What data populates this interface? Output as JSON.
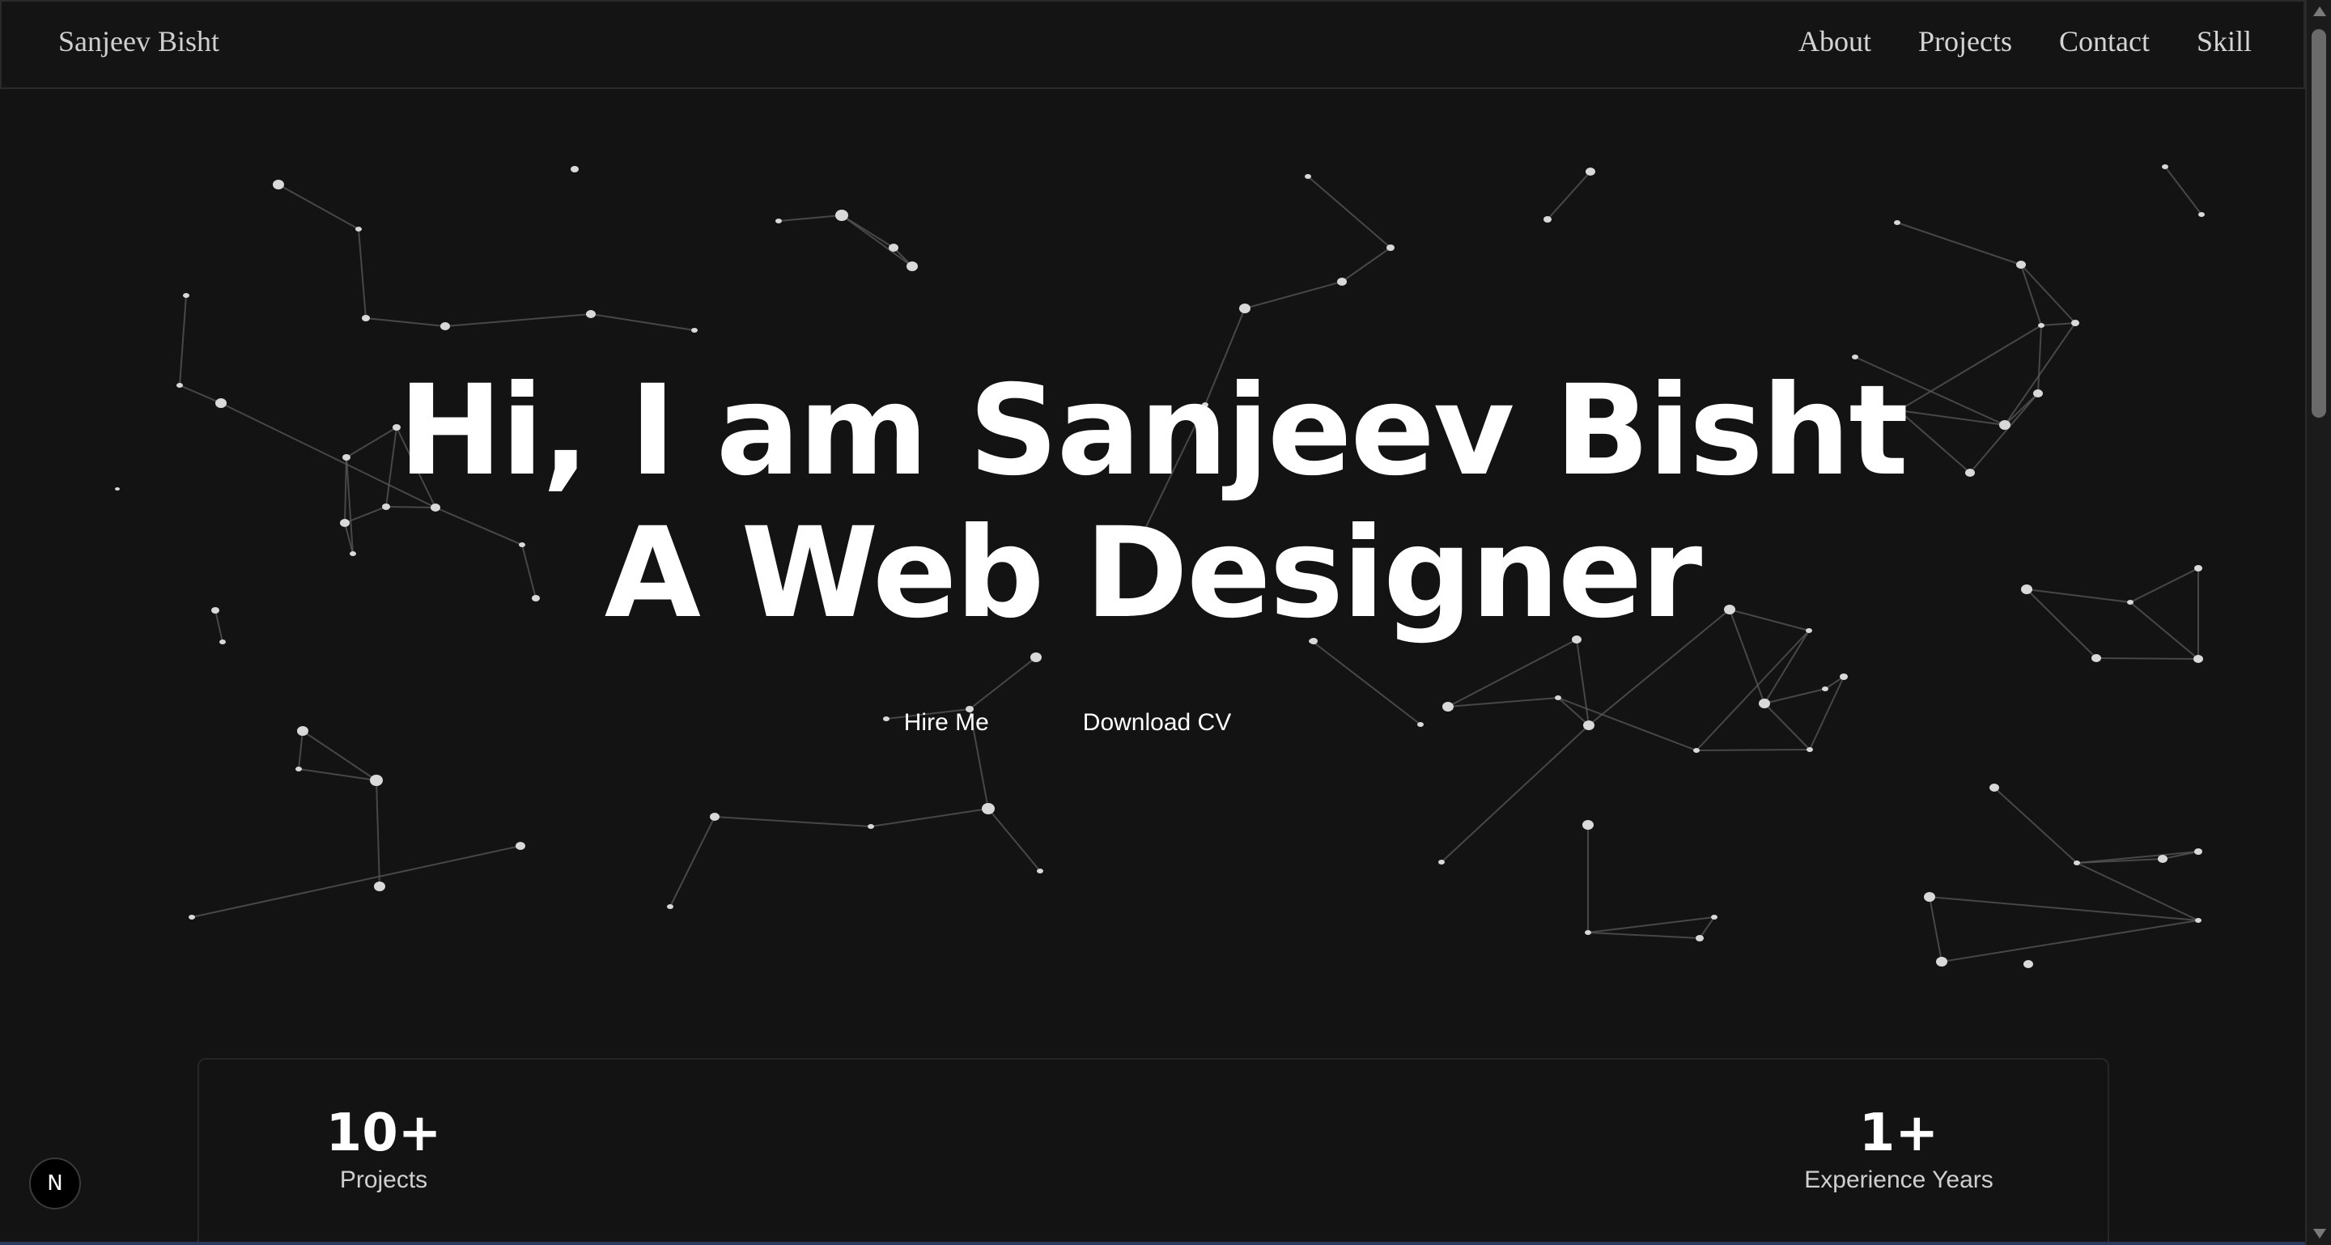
{
  "navbar": {
    "brand": "Sanjeev Bisht",
    "links": [
      "About",
      "Projects",
      "Contact",
      "Skill"
    ]
  },
  "hero": {
    "line1": "Hi, I am Sanjeev Bisht",
    "line2": "A Web Designer",
    "hire_label": "Hire Me",
    "cv_label": "Download CV"
  },
  "stats": [
    {
      "value": "10+",
      "label": "Projects"
    },
    {
      "value": "1+",
      "label": "Experience Years"
    }
  ],
  "badge": {
    "letter": "N"
  },
  "colors": {
    "background": "#131313",
    "text": "#ffffff",
    "particle": "#d9d9d9",
    "link_line": "#5a5a5a"
  },
  "icons": {
    "next_badge": "nextjs-logo-icon",
    "scroll_up": "scroll-up-arrow-icon",
    "scroll_down": "scroll-down-arrow-icon"
  }
}
